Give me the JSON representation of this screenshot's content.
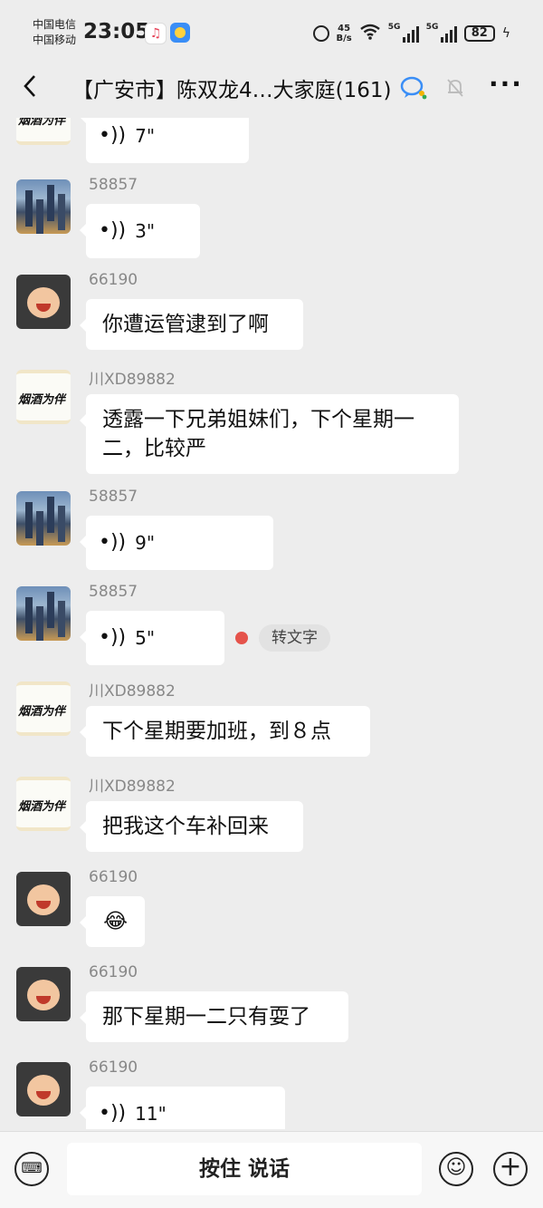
{
  "status_bar": {
    "carrier1": "中国电信",
    "carrier2": "中国移动",
    "time": "23:05",
    "speed_value": "45",
    "speed_unit": "B/s",
    "sig1_label": "5G",
    "sig2_label": "5G",
    "battery": "82"
  },
  "header": {
    "back_icon": "‹",
    "title": "【广安市】陈双龙4…大家庭(161)",
    "more_icon": "···"
  },
  "avatars": {
    "ink_text": "烟酒为伴"
  },
  "messages": [
    {
      "sender": "",
      "type": "voice",
      "text": "7\""
    },
    {
      "sender": "58857",
      "type": "voice",
      "text": "3\""
    },
    {
      "sender": "66190",
      "type": "text",
      "text": "你遭运管逮到了啊"
    },
    {
      "sender": "川XD89882",
      "type": "text",
      "text": "透露一下兄弟姐妹们，下个星期一二，比较严"
    },
    {
      "sender": "58857",
      "type": "voice",
      "text": "9\""
    },
    {
      "sender": "58857",
      "type": "voice",
      "text": "5\"",
      "convert_label": "转文字"
    },
    {
      "sender": "川XD89882",
      "type": "text",
      "text": "下个星期要加班，到８点"
    },
    {
      "sender": "川XD89882",
      "type": "text",
      "text": "把我这个车补回来"
    },
    {
      "sender": "66190",
      "type": "emoji",
      "text": "😂"
    },
    {
      "sender": "66190",
      "type": "text",
      "text": "那下星期一二只有耍了"
    },
    {
      "sender": "66190",
      "type": "voice",
      "text": "11\""
    }
  ],
  "bottom": {
    "hold_to_talk": "按住 说话"
  }
}
